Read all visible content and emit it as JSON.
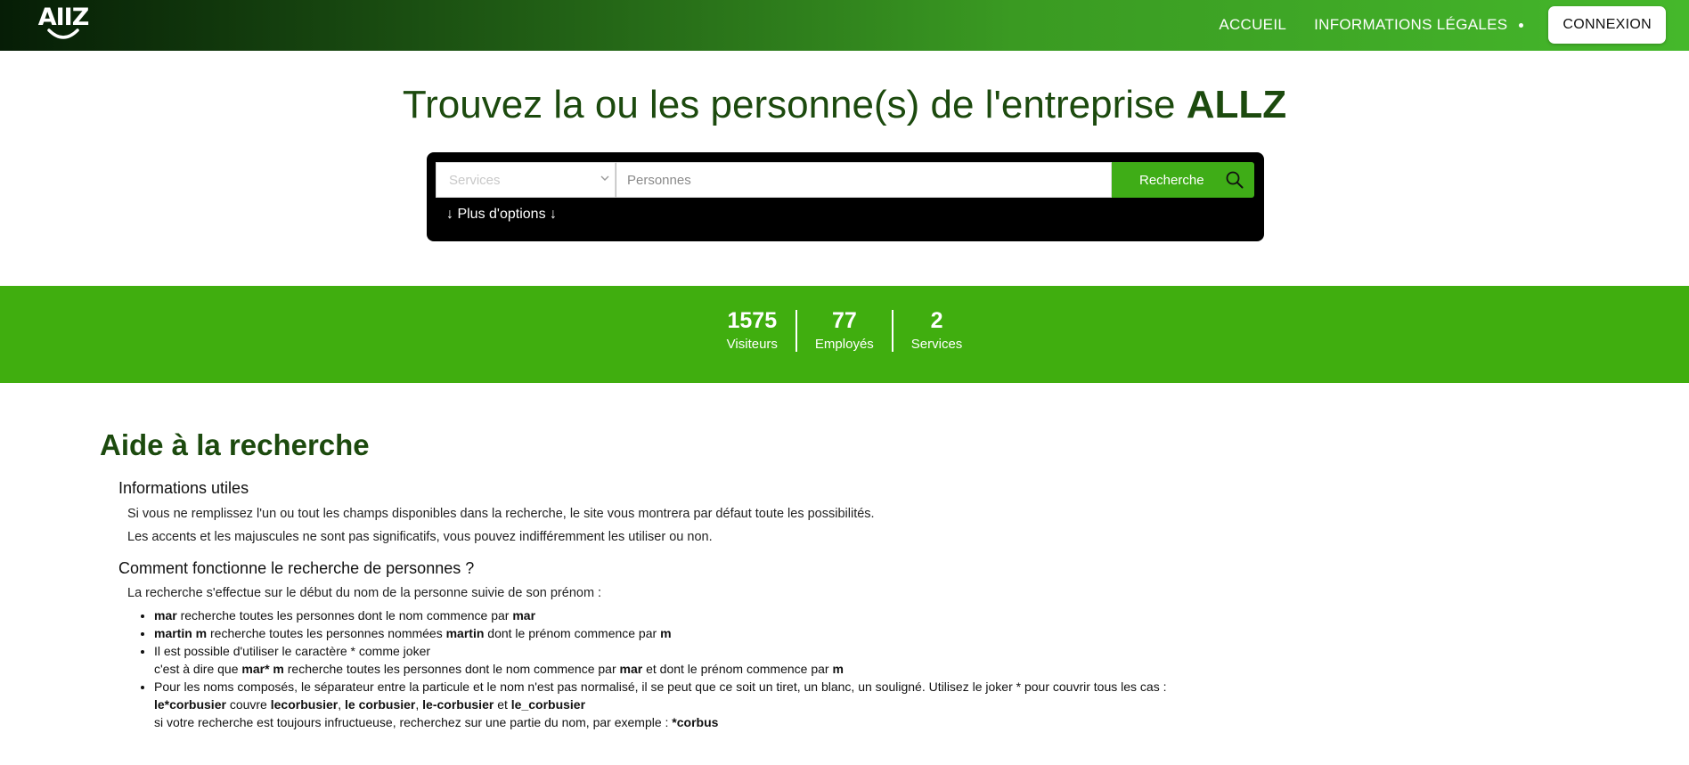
{
  "nav": {
    "logo_text": "AIIZ",
    "links": [
      "ACCUEIL",
      "INFORMATIONS LÉGALES"
    ],
    "login_label": "CONNEXION"
  },
  "hero": {
    "title_prefix": "Trouvez la ou les personne(s) de l'entreprise ",
    "title_brand": "ALLZ"
  },
  "search": {
    "services_placeholder": "Services",
    "persons_placeholder": "Personnes",
    "search_label": "Recherche",
    "more_options": "↓ Plus d'options ↓"
  },
  "stats": [
    {
      "value": "1575",
      "label": "Visiteurs"
    },
    {
      "value": "77",
      "label": "Employés"
    },
    {
      "value": "2",
      "label": "Services"
    }
  ],
  "help": {
    "title": "Aide à la recherche",
    "info_heading": "Informations utiles",
    "info_p1": "Si vous ne remplissez l'un ou tout les champs disponibles dans la recherche, le site vous montrera par défaut toute les possibilités.",
    "info_p2": "Les accents et les majuscules ne sont pas significatifs, vous pouvez indifféremment les utiliser ou non.",
    "how_heading": "Comment fonctionne le recherche de personnes ?",
    "how_intro": "La recherche s'effectue sur le début du nom de la personne suivie de son prénom :",
    "item1": {
      "b1": "mar",
      "t1": " recherche toutes les personnes dont le nom commence par ",
      "b2": "mar"
    },
    "item2": {
      "b1": "martin m",
      "t1": " recherche toutes les personnes nommées ",
      "b2": "martin",
      "t2": " dont le prénom commence par ",
      "b3": "m"
    },
    "item3": {
      "line1": "Il est possible d'utiliser le caractère * comme joker",
      "t0": "c'est à dire que ",
      "b1": "mar* m",
      "t1": " recherche toutes les personnes dont le nom commence par ",
      "b2": "mar",
      "t2": " et dont le prénom commence par ",
      "b3": "m"
    },
    "item4": {
      "line1": "Pour les noms composés, le séparateur entre la particule et le nom n'est pas normalisé, il se peut que ce soit un tiret, un blanc, un souligné. Utilisez le joker * pour couvrir tous les cas :",
      "b1": "le*corbusier",
      "t1": " couvre ",
      "b2": "lecorbusier",
      "t2": ", ",
      "b3": "le corbusier",
      "t3": ", ",
      "b4": "le-corbusier",
      "t4": " et ",
      "b5": "le_corbusier",
      "line3": "si votre recherche est toujours infructueuse, recherchez sur une partie du nom, par exemple : ",
      "b6": "*corbus"
    }
  }
}
